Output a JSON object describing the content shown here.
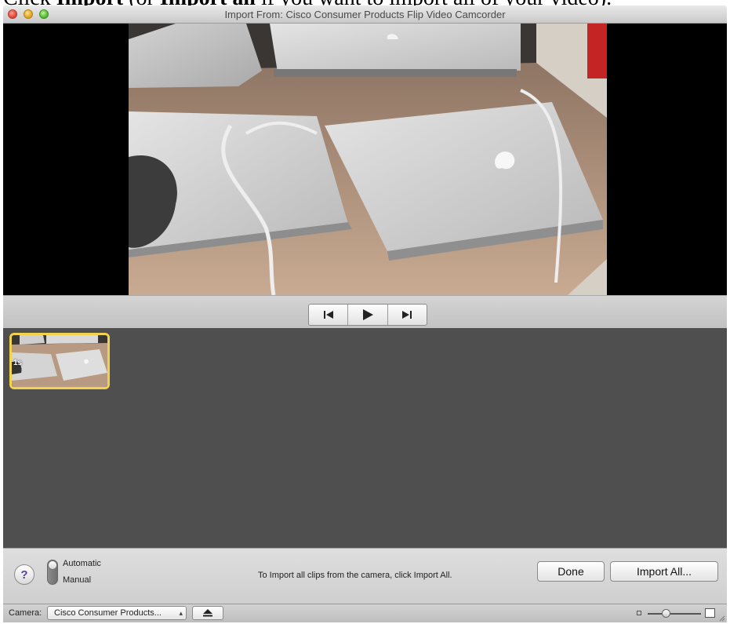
{
  "caption": {
    "text_start": "Click ",
    "bold_import": "Import",
    "text_mid": " (or ",
    "bold_import_all": "Import all",
    "text_end": " if you want to import all of your video)."
  },
  "window": {
    "title": "Import From: Cisco Consumer Products Flip Video Camcorder"
  },
  "transport": {
    "previous_icon": "skip-back-icon",
    "play_icon": "play-icon",
    "next_icon": "skip-forward-icon"
  },
  "clips": [
    {
      "duration": "1s",
      "selected": true
    }
  ],
  "bottom": {
    "mode_automatic": "Automatic",
    "mode_manual": "Manual",
    "mode_selected": "Manual",
    "info_text": "To Import all clips from the camera, click Import All.",
    "done_label": "Done",
    "import_all_label": "Import All...",
    "help_label": "?"
  },
  "statusbar": {
    "camera_label": "Camera:",
    "camera_value": "Cisco Consumer Products...",
    "eject_icon": "eject-icon",
    "zoom_level": 0.35
  },
  "colors": {
    "selection": "#f2d24b",
    "browser_bg": "#4f4f4f",
    "help_glyph": "#5c3f9a"
  }
}
